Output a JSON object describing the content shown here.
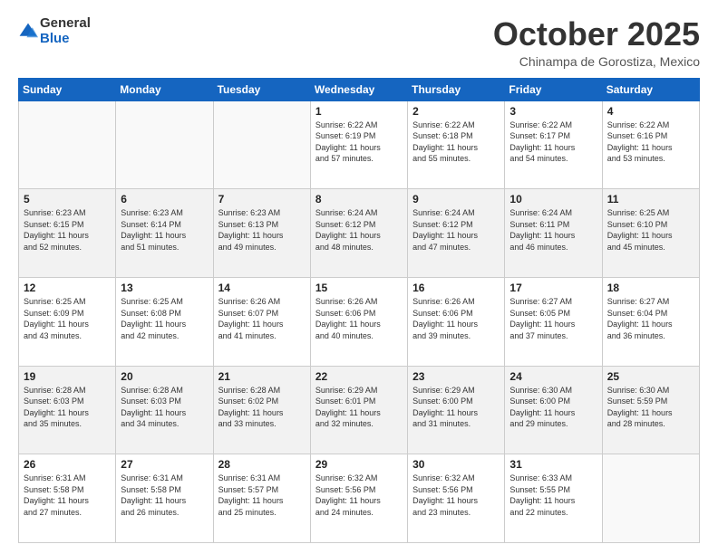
{
  "header": {
    "logo_general": "General",
    "logo_blue": "Blue",
    "month_title": "October 2025",
    "location": "Chinampa de Gorostiza, Mexico"
  },
  "days_of_week": [
    "Sunday",
    "Monday",
    "Tuesday",
    "Wednesday",
    "Thursday",
    "Friday",
    "Saturday"
  ],
  "weeks": [
    [
      {
        "day": "",
        "info": ""
      },
      {
        "day": "",
        "info": ""
      },
      {
        "day": "",
        "info": ""
      },
      {
        "day": "1",
        "info": "Sunrise: 6:22 AM\nSunset: 6:19 PM\nDaylight: 11 hours\nand 57 minutes."
      },
      {
        "day": "2",
        "info": "Sunrise: 6:22 AM\nSunset: 6:18 PM\nDaylight: 11 hours\nand 55 minutes."
      },
      {
        "day": "3",
        "info": "Sunrise: 6:22 AM\nSunset: 6:17 PM\nDaylight: 11 hours\nand 54 minutes."
      },
      {
        "day": "4",
        "info": "Sunrise: 6:22 AM\nSunset: 6:16 PM\nDaylight: 11 hours\nand 53 minutes."
      }
    ],
    [
      {
        "day": "5",
        "info": "Sunrise: 6:23 AM\nSunset: 6:15 PM\nDaylight: 11 hours\nand 52 minutes."
      },
      {
        "day": "6",
        "info": "Sunrise: 6:23 AM\nSunset: 6:14 PM\nDaylight: 11 hours\nand 51 minutes."
      },
      {
        "day": "7",
        "info": "Sunrise: 6:23 AM\nSunset: 6:13 PM\nDaylight: 11 hours\nand 49 minutes."
      },
      {
        "day": "8",
        "info": "Sunrise: 6:24 AM\nSunset: 6:12 PM\nDaylight: 11 hours\nand 48 minutes."
      },
      {
        "day": "9",
        "info": "Sunrise: 6:24 AM\nSunset: 6:12 PM\nDaylight: 11 hours\nand 47 minutes."
      },
      {
        "day": "10",
        "info": "Sunrise: 6:24 AM\nSunset: 6:11 PM\nDaylight: 11 hours\nand 46 minutes."
      },
      {
        "day": "11",
        "info": "Sunrise: 6:25 AM\nSunset: 6:10 PM\nDaylight: 11 hours\nand 45 minutes."
      }
    ],
    [
      {
        "day": "12",
        "info": "Sunrise: 6:25 AM\nSunset: 6:09 PM\nDaylight: 11 hours\nand 43 minutes."
      },
      {
        "day": "13",
        "info": "Sunrise: 6:25 AM\nSunset: 6:08 PM\nDaylight: 11 hours\nand 42 minutes."
      },
      {
        "day": "14",
        "info": "Sunrise: 6:26 AM\nSunset: 6:07 PM\nDaylight: 11 hours\nand 41 minutes."
      },
      {
        "day": "15",
        "info": "Sunrise: 6:26 AM\nSunset: 6:06 PM\nDaylight: 11 hours\nand 40 minutes."
      },
      {
        "day": "16",
        "info": "Sunrise: 6:26 AM\nSunset: 6:06 PM\nDaylight: 11 hours\nand 39 minutes."
      },
      {
        "day": "17",
        "info": "Sunrise: 6:27 AM\nSunset: 6:05 PM\nDaylight: 11 hours\nand 37 minutes."
      },
      {
        "day": "18",
        "info": "Sunrise: 6:27 AM\nSunset: 6:04 PM\nDaylight: 11 hours\nand 36 minutes."
      }
    ],
    [
      {
        "day": "19",
        "info": "Sunrise: 6:28 AM\nSunset: 6:03 PM\nDaylight: 11 hours\nand 35 minutes."
      },
      {
        "day": "20",
        "info": "Sunrise: 6:28 AM\nSunset: 6:03 PM\nDaylight: 11 hours\nand 34 minutes."
      },
      {
        "day": "21",
        "info": "Sunrise: 6:28 AM\nSunset: 6:02 PM\nDaylight: 11 hours\nand 33 minutes."
      },
      {
        "day": "22",
        "info": "Sunrise: 6:29 AM\nSunset: 6:01 PM\nDaylight: 11 hours\nand 32 minutes."
      },
      {
        "day": "23",
        "info": "Sunrise: 6:29 AM\nSunset: 6:00 PM\nDaylight: 11 hours\nand 31 minutes."
      },
      {
        "day": "24",
        "info": "Sunrise: 6:30 AM\nSunset: 6:00 PM\nDaylight: 11 hours\nand 29 minutes."
      },
      {
        "day": "25",
        "info": "Sunrise: 6:30 AM\nSunset: 5:59 PM\nDaylight: 11 hours\nand 28 minutes."
      }
    ],
    [
      {
        "day": "26",
        "info": "Sunrise: 6:31 AM\nSunset: 5:58 PM\nDaylight: 11 hours\nand 27 minutes."
      },
      {
        "day": "27",
        "info": "Sunrise: 6:31 AM\nSunset: 5:58 PM\nDaylight: 11 hours\nand 26 minutes."
      },
      {
        "day": "28",
        "info": "Sunrise: 6:31 AM\nSunset: 5:57 PM\nDaylight: 11 hours\nand 25 minutes."
      },
      {
        "day": "29",
        "info": "Sunrise: 6:32 AM\nSunset: 5:56 PM\nDaylight: 11 hours\nand 24 minutes."
      },
      {
        "day": "30",
        "info": "Sunrise: 6:32 AM\nSunset: 5:56 PM\nDaylight: 11 hours\nand 23 minutes."
      },
      {
        "day": "31",
        "info": "Sunrise: 6:33 AM\nSunset: 5:55 PM\nDaylight: 11 hours\nand 22 minutes."
      },
      {
        "day": "",
        "info": ""
      }
    ]
  ]
}
